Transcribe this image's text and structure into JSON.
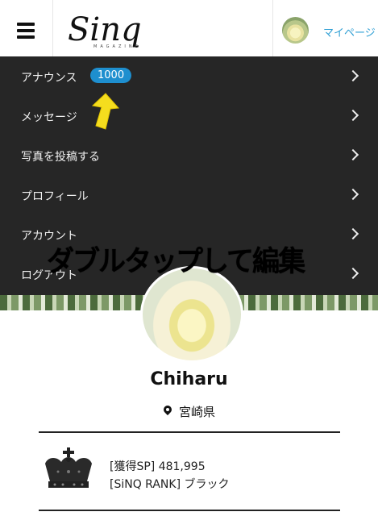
{
  "header": {
    "logo_text": "Sinq",
    "logo_subtext": "MAGAZINE",
    "mypage_label": "マイページ"
  },
  "menu": {
    "items": [
      {
        "label": "アナウンス",
        "badge": "1000"
      },
      {
        "label": "メッセージ"
      },
      {
        "label": "写真を投稿する"
      },
      {
        "label": "プロフィール"
      },
      {
        "label": "アカウント"
      },
      {
        "label": "ログアウト"
      }
    ]
  },
  "overlay_text": "ダブルタップして編集",
  "profile": {
    "name": "Chiharu",
    "location": "宮崎県",
    "points": "[獲得SP] 481,995",
    "rank": "[SiNQ RANK] ブラック"
  },
  "colors": {
    "accent_blue": "#1e8fcf",
    "menu_bg": "#262626",
    "arrow_yellow": "#f5dd1e"
  }
}
